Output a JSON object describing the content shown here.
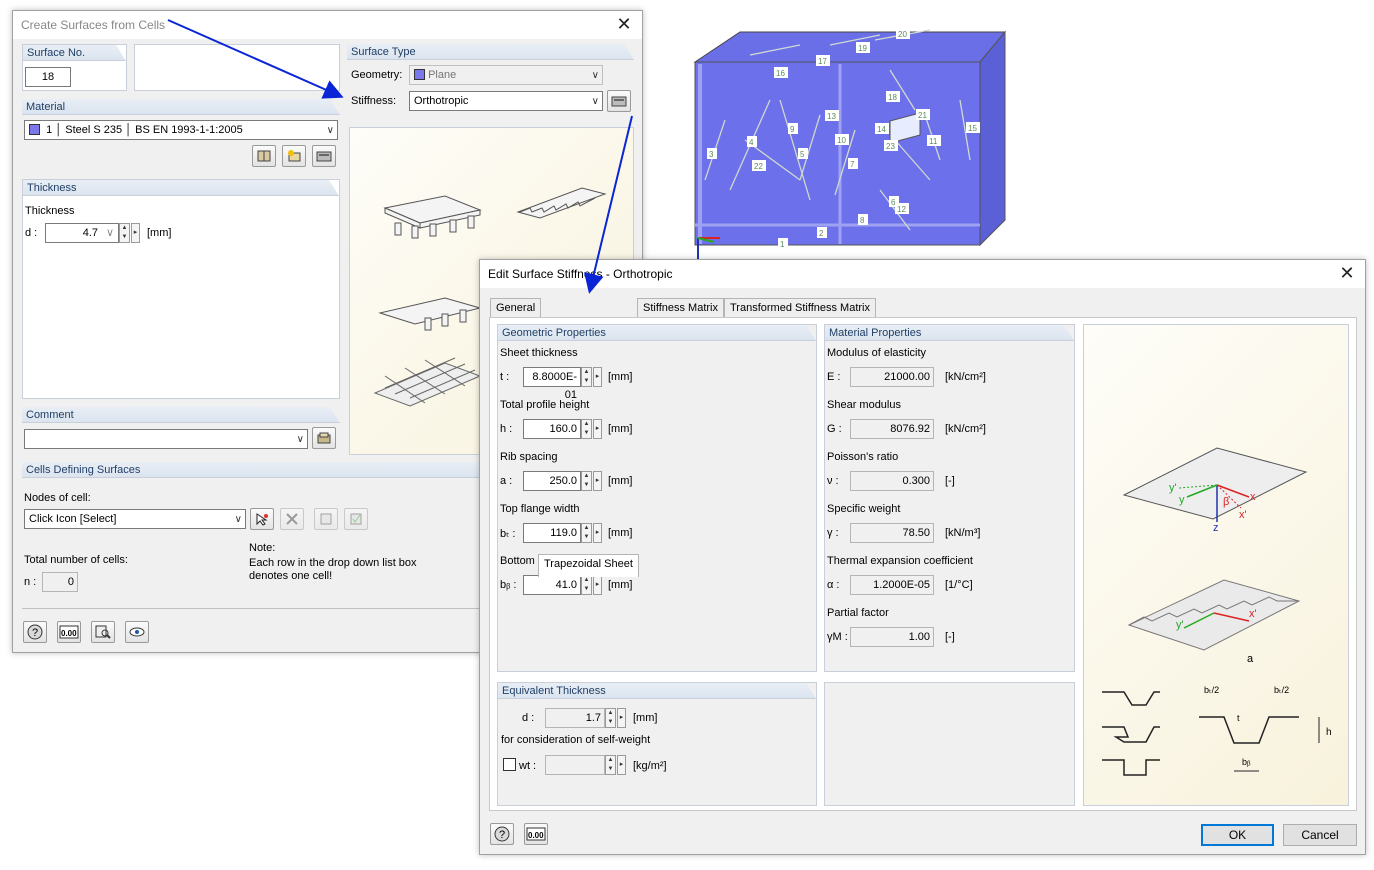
{
  "main_dialog": {
    "title": "Create Surfaces from Cells",
    "surface_no": {
      "label": "Surface No.",
      "value": "18"
    },
    "surface_type": {
      "header": "Surface Type",
      "geometry_label": "Geometry:",
      "geometry_value": "Plane",
      "stiffness_label": "Stiffness:",
      "stiffness_value": "Orthotropic"
    },
    "material": {
      "header": "Material",
      "number": "1",
      "name": "Steel S 235",
      "standard": "BS EN 1993-1-1:2005"
    },
    "thickness": {
      "header": "Thickness",
      "label": "Thickness",
      "symbol": "d :",
      "value": "4.7",
      "unit": "[mm]"
    },
    "comment": {
      "header": "Comment",
      "value": ""
    },
    "cells": {
      "header": "Cells Defining Surfaces",
      "nodes_label": "Nodes of cell:",
      "nodes_value": "Click Icon [Select]",
      "total_label": "Total number of cells:",
      "n_symbol": "n :",
      "n_value": "0",
      "note_title": "Note:",
      "note_line1": "Each row in the drop down list box",
      "note_line2": "denotes one cell!"
    },
    "colors": {
      "material_swatch": "#7a78ea",
      "accent": "#1f3f66"
    }
  },
  "stiffness_dialog": {
    "title": "Edit Surface Stiffness - Orthotropic",
    "tabs": [
      "General",
      "Trapezoidal Sheet",
      "Stiffness Matrix",
      "Transformed Stiffness Matrix"
    ],
    "active_tab": "Trapezoidal Sheet",
    "geometric": {
      "header": "Geometric Properties",
      "rows": [
        {
          "label": "Sheet thickness",
          "sym": "t :",
          "value": "8.8000E-01",
          "unit": "[mm]"
        },
        {
          "label": "Total profile height",
          "sym": "h :",
          "value": "160.0",
          "unit": "[mm]"
        },
        {
          "label": "Rib spacing",
          "sym": "a :",
          "value": "250.0",
          "unit": "[mm]"
        },
        {
          "label": "Top flange width",
          "sym": "bₜ :",
          "value": "119.0",
          "unit": "[mm]"
        },
        {
          "label": "Bottom flange width",
          "sym": "bᵦ :",
          "value": "41.0",
          "unit": "[mm]"
        }
      ]
    },
    "material": {
      "header": "Material Properties",
      "rows": [
        {
          "label": "Modulus of elasticity",
          "sym": "E :",
          "value": "21000.00",
          "unit": "[kN/cm²]"
        },
        {
          "label": "Shear modulus",
          "sym": "G :",
          "value": "8076.92",
          "unit": "[kN/cm²]"
        },
        {
          "label": "Poisson's ratio",
          "sym": "ν :",
          "value": "0.300",
          "unit": "[-]"
        },
        {
          "label": "Specific weight",
          "sym": "γ :",
          "value": "78.50",
          "unit": "[kN/m³]"
        },
        {
          "label": "Thermal expansion coefficient",
          "sym": "α :",
          "value": "1.2000E-05",
          "unit": "[1/°C]"
        },
        {
          "label": "Partial factor",
          "sym": "γM :",
          "value": "1.00",
          "unit": "[-]"
        }
      ]
    },
    "equivalent": {
      "header": "Equivalent Thickness",
      "d_sym": "d :",
      "d_value": "1.7",
      "d_unit": "[mm]",
      "selfweight_label": "for consideration of self-weight",
      "wt_label": "wt :",
      "wt_value": "",
      "wt_unit": "[kg/m²]"
    },
    "diagram_labels": {
      "bt2": "bₜ/2",
      "bb": "bᵦ",
      "t": "t",
      "h": "h",
      "a": "a",
      "x": "x",
      "x_prime": "x'",
      "y": "y",
      "y_prime": "y'",
      "z": "z",
      "beta": "β"
    },
    "ok_label": "OK",
    "cancel_label": "Cancel"
  },
  "model_view": {
    "surface_numbers": [
      "20",
      "19",
      "17",
      "16",
      "18",
      "13",
      "9",
      "10",
      "14",
      "21",
      "15",
      "3",
      "4",
      "22",
      "5",
      "7",
      "23",
      "11",
      "6",
      "12",
      "8",
      "2",
      "1"
    ]
  }
}
